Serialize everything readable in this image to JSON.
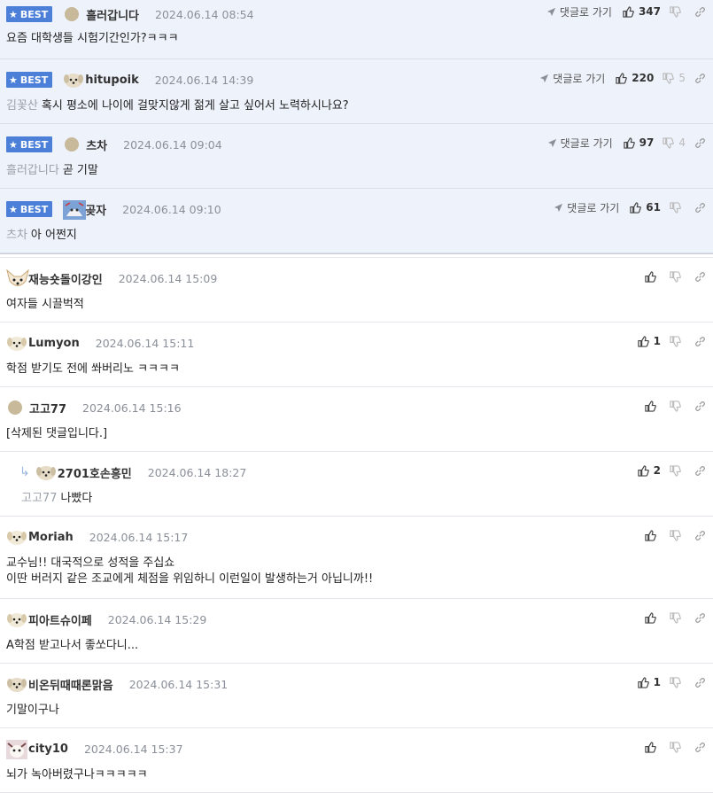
{
  "labels": {
    "best": "BEST",
    "reply_link": "댓글로 가기"
  },
  "best_comments": [
    {
      "nick": "흘러갑니다",
      "date": "2024.06.14 08:54",
      "ref": "",
      "text": "요즘 대학생들 시험기간인가?ㅋㅋㅋ",
      "likes": "347",
      "dislikes": "",
      "avatar": "dot"
    },
    {
      "nick": "hitupoik",
      "date": "2024.06.14 14:39",
      "ref": "김꽃산",
      "text": "혹시 평소에 나이에 걸맞지않게 젊게 살고 싶어서 노력하시나요?",
      "likes": "220",
      "dislikes": "5",
      "avatar": "dog"
    },
    {
      "nick": "츠차",
      "date": "2024.06.14 09:04",
      "ref": "흘러갑니다",
      "text": "곧 기말",
      "likes": "97",
      "dislikes": "4",
      "avatar": "dot"
    },
    {
      "nick": "곶자",
      "date": "2024.06.14 09:10",
      "ref": "츠차",
      "text": "아 어쩐지",
      "likes": "61",
      "dislikes": "",
      "avatar": "img"
    }
  ],
  "comments": [
    {
      "nick": "재능숏돌이강인",
      "date": "2024.06.14 15:09",
      "ref": "",
      "text": "여자들 시끌벅적",
      "text2": "",
      "likes": "",
      "avatar": "fox",
      "reply": false
    },
    {
      "nick": "Lumyon",
      "date": "2024.06.14 15:11",
      "ref": "",
      "text": "학점 받기도 전에 쏴버리노 ㅋㅋㅋㅋ",
      "text2": "",
      "likes": "1",
      "avatar": "dog",
      "reply": false
    },
    {
      "nick": "고고77",
      "date": "2024.06.14 15:16",
      "ref": "",
      "text": "[삭제된 댓글입니다.]",
      "text2": "",
      "likes": "",
      "avatar": "dot",
      "reply": false
    },
    {
      "nick": "2701호손흥민",
      "date": "2024.06.14 18:27",
      "ref": "고고77",
      "text": "나빴다",
      "text2": "",
      "likes": "2",
      "avatar": "dog2",
      "reply": true
    },
    {
      "nick": "Moriah",
      "date": "2024.06.14 15:17",
      "ref": "",
      "text": "교수님!! 대국적으로 성적을 주십쇼",
      "text2": "이딴 버러지 같은 조교에게 체점을 위임하니 이런일이 발생하는거 아닙니까!!",
      "likes": "",
      "avatar": "dog",
      "reply": false
    },
    {
      "nick": "피아트슈이페",
      "date": "2024.06.14 15:29",
      "ref": "",
      "text": "A학점 받고나서 좋쏘다니...",
      "text2": "",
      "likes": "",
      "avatar": "dog",
      "reply": false
    },
    {
      "nick": "비온뒤때때론맑음",
      "date": "2024.06.14 15:31",
      "ref": "",
      "text": "기말이구나",
      "text2": "",
      "likes": "1",
      "avatar": "dog2",
      "reply": false
    },
    {
      "nick": "city10",
      "date": "2024.06.14 15:37",
      "ref": "",
      "text": "뇌가 녹아버렸구나ㅋㅋㅋㅋㅋ",
      "text2": "",
      "likes": "",
      "avatar": "img2",
      "reply": false
    }
  ]
}
